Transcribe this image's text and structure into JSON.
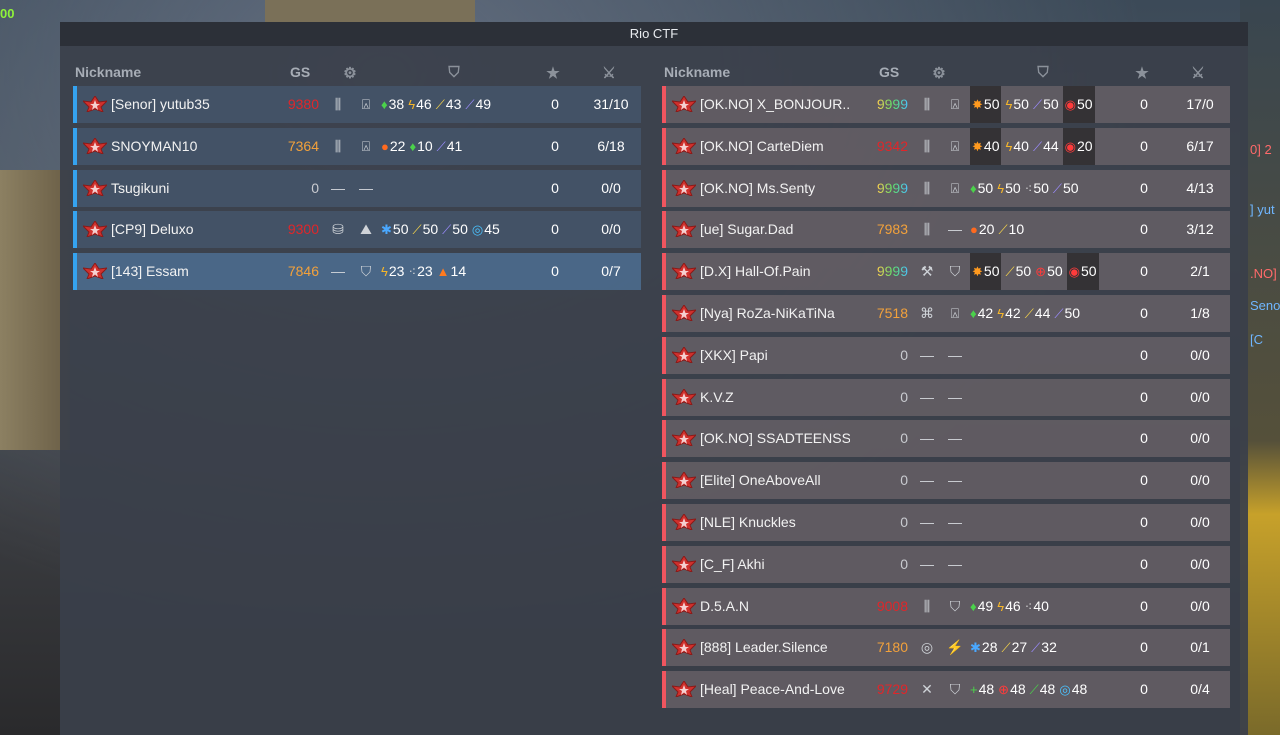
{
  "hud": {
    "corner_value": "00",
    "side_lines": [
      "0] 2",
      "] yut",
      ".NO]",
      "Senor",
      "[C"
    ]
  },
  "title": "Rio CTF",
  "headers": {
    "nickname": "Nickname",
    "gs": "GS"
  },
  "colors": {
    "blue_team": "#35a3f0",
    "red_team": "#f0555f",
    "gs_red": "#e0262a",
    "gs_orange": "#f2a13b"
  },
  "blue_team": [
    {
      "nick": "[Senor] yutub35",
      "gs": "9380",
      "gs_color": "red",
      "turret": "railgun-icon",
      "hull": "titan-icon",
      "drugs": [
        {
          "icon": "♦",
          "color": "#4bd24b",
          "value": "38"
        },
        {
          "icon": "ϟ",
          "color": "#f5b62a",
          "value": "46"
        },
        {
          "icon": "⟋",
          "color": "#f7d54a",
          "value": "43"
        },
        {
          "icon": "⟋",
          "color": "#9c8cff",
          "value": "49"
        }
      ],
      "score": "0",
      "kd": "31/10",
      "me": false
    },
    {
      "nick": "SNOYMAN10",
      "gs": "7364",
      "gs_color": "orange",
      "turret": "railgun-icon",
      "hull": "titan-icon",
      "drugs": [
        {
          "icon": "●",
          "color": "#ff6a1f",
          "value": "22"
        },
        {
          "icon": "♦",
          "color": "#4bd24b",
          "value": "10"
        },
        {
          "icon": "⟋",
          "color": "#9c8cff",
          "value": "41"
        }
      ],
      "score": "0",
      "kd": "6/18",
      "me": false
    },
    {
      "nick": "Tsugikuni",
      "gs": "0",
      "gs_color": "grey",
      "turret": "—",
      "hull": "—",
      "drugs": [],
      "score": "0",
      "kd": "0/0",
      "me": false
    },
    {
      "nick": "[CP9] Deluxo",
      "gs": "9300",
      "gs_color": "red",
      "turret": "gauss-icon",
      "hull": "mammoth-icon",
      "drugs": [
        {
          "icon": "✱",
          "color": "#4aa8ff",
          "value": "50"
        },
        {
          "icon": "⟋",
          "color": "#f7d54a",
          "value": "50"
        },
        {
          "icon": "⟋",
          "color": "#9c8cff",
          "value": "50"
        },
        {
          "icon": "◎",
          "color": "#4ac3ff",
          "value": "45"
        }
      ],
      "score": "0",
      "kd": "0/0",
      "me": false
    },
    {
      "nick": "[143] Essam",
      "gs": "7846",
      "gs_color": "orange",
      "turret": "—",
      "hull": "shield-hull-icon",
      "drugs": [
        {
          "icon": "ϟ",
          "color": "#f5b62a",
          "value": "23"
        },
        {
          "icon": "⁖",
          "color": "#d8d8d8",
          "value": "23"
        },
        {
          "icon": "▲",
          "color": "#ff7a1f",
          "value": "14"
        }
      ],
      "score": "0",
      "kd": "0/7",
      "me": true
    }
  ],
  "red_team": [
    {
      "nick": "[OK.NO] X_BONJOUR...",
      "gs": "9999",
      "gs_color": "rainbow",
      "turret": "railgun-icon",
      "hull": "titan-icon",
      "drugs": [
        {
          "icon": "✸",
          "color": "#ff9a1f",
          "value": "50",
          "box": true
        },
        {
          "icon": "ϟ",
          "color": "#f5b62a",
          "value": "50"
        },
        {
          "icon": "⟋",
          "color": "#9c8cff",
          "value": "50"
        },
        {
          "icon": "◉",
          "color": "#ff3b3b",
          "value": "50",
          "box": true
        }
      ],
      "score": "0",
      "kd": "17/0"
    },
    {
      "nick": "[OK.NO] CarteDiem",
      "gs": "9342",
      "gs_color": "red",
      "turret": "railgun-icon",
      "hull": "titan-icon",
      "drugs": [
        {
          "icon": "✸",
          "color": "#ff9a1f",
          "value": "40",
          "box": true
        },
        {
          "icon": "ϟ",
          "color": "#f5b62a",
          "value": "40"
        },
        {
          "icon": "⟋",
          "color": "#9c8cff",
          "value": "44"
        },
        {
          "icon": "◉",
          "color": "#ff3b3b",
          "value": "20",
          "box": true
        }
      ],
      "score": "0",
      "kd": "6/17"
    },
    {
      "nick": "[OK.NO] Ms.Senty",
      "gs": "9999",
      "gs_color": "rainbow",
      "turret": "railgun-icon",
      "hull": "titan-icon",
      "drugs": [
        {
          "icon": "♦",
          "color": "#4bd24b",
          "value": "50"
        },
        {
          "icon": "ϟ",
          "color": "#f5b62a",
          "value": "50"
        },
        {
          "icon": "⁖",
          "color": "#d8d8d8",
          "value": "50"
        },
        {
          "icon": "⟋",
          "color": "#9c8cff",
          "value": "50"
        }
      ],
      "score": "0",
      "kd": "4/13"
    },
    {
      "nick": "[ue] Sugar.Dad",
      "gs": "7983",
      "gs_color": "orange",
      "turret": "railgun-icon",
      "hull": "—",
      "drugs": [
        {
          "icon": "●",
          "color": "#ff6a1f",
          "value": "20"
        },
        {
          "icon": "⟋",
          "color": "#f7d54a",
          "value": "10"
        }
      ],
      "score": "0",
      "kd": "3/12"
    },
    {
      "nick": "[D.X] Hall-Of.Pain",
      "gs": "9999",
      "gs_color": "rainbow",
      "turret": "hammer-icon",
      "hull": "shield-hull-icon",
      "drugs": [
        {
          "icon": "✸",
          "color": "#ff9a1f",
          "value": "50",
          "box": true
        },
        {
          "icon": "⟋",
          "color": "#f7d54a",
          "value": "50"
        },
        {
          "icon": "⊕",
          "color": "#ff3b3b",
          "value": "50"
        },
        {
          "icon": "◉",
          "color": "#ff3b3b",
          "value": "50",
          "box": true
        }
      ],
      "score": "0",
      "kd": "2/1"
    },
    {
      "nick": "[Nya] RoZa-NiKaTiNa",
      "gs": "7518",
      "gs_color": "orange",
      "turret": "striker-icon",
      "hull": "titan-icon",
      "drugs": [
        {
          "icon": "♦",
          "color": "#4bd24b",
          "value": "42"
        },
        {
          "icon": "ϟ",
          "color": "#f5b62a",
          "value": "42"
        },
        {
          "icon": "⟋",
          "color": "#f7d54a",
          "value": "44"
        },
        {
          "icon": "⟋",
          "color": "#9c8cff",
          "value": "50"
        }
      ],
      "score": "0",
      "kd": "1/8"
    },
    {
      "nick": "[XKX] Papi",
      "gs": "0",
      "gs_color": "grey",
      "turret": "—",
      "hull": "—",
      "drugs": [],
      "score": "0",
      "kd": "0/0"
    },
    {
      "nick": "K.V.Z",
      "gs": "0",
      "gs_color": "grey",
      "turret": "—",
      "hull": "—",
      "drugs": [],
      "score": "0",
      "kd": "0/0"
    },
    {
      "nick": "[OK.NO] SSADTEENSS",
      "gs": "0",
      "gs_color": "grey",
      "turret": "—",
      "hull": "—",
      "drugs": [],
      "score": "0",
      "kd": "0/0"
    },
    {
      "nick": "[Elite] OneAboveAll",
      "gs": "0",
      "gs_color": "grey",
      "turret": "—",
      "hull": "—",
      "drugs": [],
      "score": "0",
      "kd": "0/0"
    },
    {
      "nick": "[NLE] Knuckles",
      "gs": "0",
      "gs_color": "grey",
      "turret": "—",
      "hull": "—",
      "drugs": [],
      "score": "0",
      "kd": "0/0"
    },
    {
      "nick": "[C_F] Akhi",
      "gs": "0",
      "gs_color": "grey",
      "turret": "—",
      "hull": "—",
      "drugs": [],
      "score": "0",
      "kd": "0/0"
    },
    {
      "nick": "D.5.A.N",
      "gs": "9008",
      "gs_color": "red",
      "turret": "railgun-icon",
      "hull": "shield-hull-icon",
      "drugs": [
        {
          "icon": "♦",
          "color": "#4bd24b",
          "value": "49"
        },
        {
          "icon": "ϟ",
          "color": "#f5b62a",
          "value": "46"
        },
        {
          "icon": "⁖",
          "color": "#d8d8d8",
          "value": "40"
        }
      ],
      "score": "0",
      "kd": "0/0"
    },
    {
      "nick": "[888] Leader.Silence",
      "gs": "7180",
      "gs_color": "orange",
      "turret": "target-icon",
      "hull": "wasp-icon",
      "drugs": [
        {
          "icon": "✱",
          "color": "#4aa8ff",
          "value": "28"
        },
        {
          "icon": "⟋",
          "color": "#f7d54a",
          "value": "27"
        },
        {
          "icon": "⟋",
          "color": "#9c8cff",
          "value": "32"
        }
      ],
      "score": "0",
      "kd": "0/1"
    },
    {
      "nick": "[Heal] Peace-And-Love",
      "gs": "9729",
      "gs_color": "red",
      "turret": "crossed-swords-icon",
      "hull": "shield-hull-icon",
      "drugs": [
        {
          "icon": "+",
          "color": "#4bd24b",
          "value": "48"
        },
        {
          "icon": "⊕",
          "color": "#ff3b3b",
          "value": "48"
        },
        {
          "icon": "⟋",
          "color": "#4bd24b",
          "value": "48"
        },
        {
          "icon": "◎",
          "color": "#4ac3ff",
          "value": "48"
        }
      ],
      "score": "0",
      "kd": "0/4"
    }
  ]
}
